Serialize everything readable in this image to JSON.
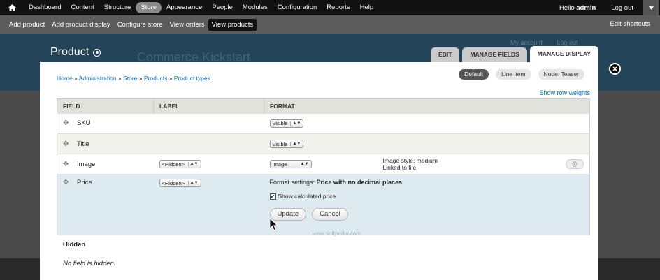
{
  "toolbar": {
    "menu": [
      "Dashboard",
      "Content",
      "Structure",
      "Store",
      "Appearance",
      "People",
      "Modules",
      "Configuration",
      "Reports",
      "Help"
    ],
    "active_item": "Store",
    "hello_prefix": "Hello ",
    "username": "admin",
    "logout": "Log out"
  },
  "shortcuts": {
    "items": [
      "Add product",
      "Add product display",
      "Configure store",
      "View orders",
      "View products"
    ],
    "active_item": "View products",
    "edit_label": "Edit shortcuts"
  },
  "background": {
    "site_name": "Commerce Kickstart",
    "links": [
      "My account",
      "Log out"
    ]
  },
  "overlay": {
    "title": "Product",
    "tabs": [
      "EDIT",
      "MANAGE FIELDS",
      "MANAGE DISPLAY"
    ],
    "active_tab": "MANAGE DISPLAY"
  },
  "breadcrumb": [
    "Home",
    "Administration",
    "Store",
    "Products",
    "Product types"
  ],
  "breadcrumb_sep": "»",
  "subtabs": [
    "Default",
    "Line item",
    "Node: Teaser"
  ],
  "active_subtab": "Default",
  "show_row_weights": "Show row weights",
  "table": {
    "headers": [
      "FIELD",
      "LABEL",
      "FORMAT"
    ],
    "rows": [
      {
        "field": "SKU",
        "label": "",
        "format": "Visible",
        "summary": []
      },
      {
        "field": "Title",
        "label": "",
        "format": "Visible",
        "summary": []
      },
      {
        "field": "Image",
        "label": "<Hidden>",
        "format": "Image",
        "summary": [
          "Image style: medium",
          "Linked to file"
        ]
      },
      {
        "field": "Price",
        "label": "<Hidden>",
        "format": ""
      }
    ]
  },
  "price_edit": {
    "settings_prefix": "Format settings: ",
    "settings_value": "Price with no decimal places",
    "checkbox_label": "Show calculated price",
    "checkbox_checked": true,
    "update_button": "Update",
    "cancel_button": "Cancel"
  },
  "hidden_section": {
    "title": "Hidden",
    "message": "No field is hidden."
  },
  "watermark": "www.softpedia.com"
}
